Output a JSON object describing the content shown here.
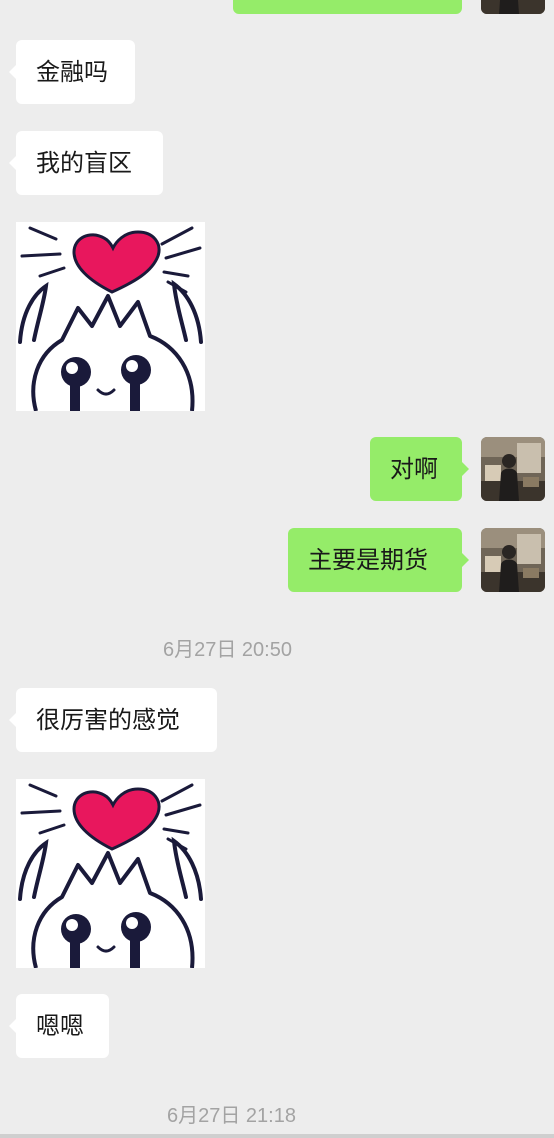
{
  "colors": {
    "background": "#ededed",
    "bubble_in": "#ffffff",
    "bubble_out": "#95ec69",
    "timestamp": "#a3a3a3",
    "heart": "#e8175d"
  },
  "messages": [
    {
      "side": "received",
      "text": "金融吗"
    },
    {
      "side": "received",
      "text": "我的盲区"
    },
    {
      "side": "received",
      "type": "sticker",
      "icon": "heart-cat-sticker"
    },
    {
      "side": "sent",
      "text": "对啊"
    },
    {
      "side": "sent",
      "text": "主要是期货"
    },
    {
      "side": "received",
      "text": "很厉害的感觉"
    },
    {
      "side": "received",
      "type": "sticker",
      "icon": "heart-cat-sticker"
    },
    {
      "side": "received",
      "text": "嗯嗯"
    }
  ],
  "timestamps": [
    "6月27日 20:50",
    "6月27日 21:18"
  ]
}
